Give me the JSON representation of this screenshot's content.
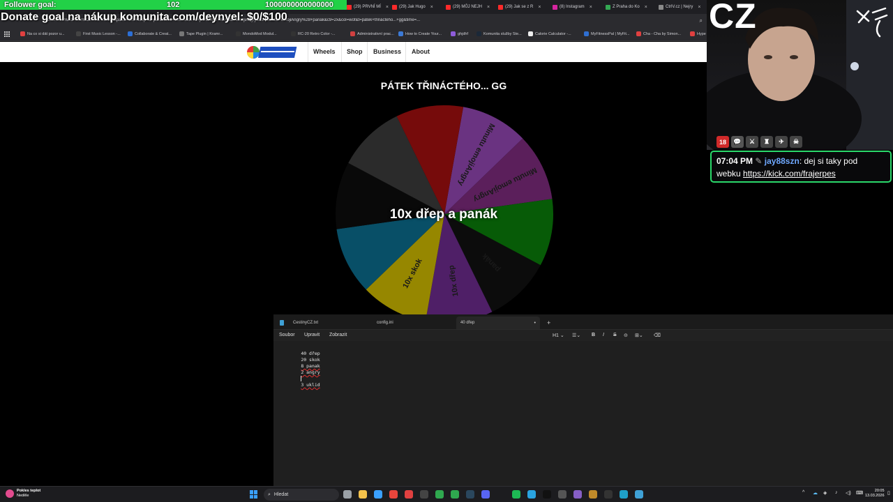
{
  "overlay": {
    "follower_goal_label": "Follower goal:",
    "follower_current": "102",
    "follower_target": "1000000000000000",
    "donate_text": "Donate goal na nákup komunita.com/deynyel: $0/$100"
  },
  "browser": {
    "tabs": [
      {
        "label": "(29) PRVNÍ MÍ",
        "color": "#ff2a2a"
      },
      {
        "label": "(29) Jak Hugo",
        "color": "#ff2a2a"
      },
      {
        "label": "(29) MŮJ NEJH",
        "color": "#ff2a2a"
      },
      {
        "label": "(29) Jak se z R",
        "color": "#ff2a2a"
      },
      {
        "label": "(8) Instagram",
        "color": "#d6249f"
      },
      {
        "label": "Z Praha do Ko",
        "color": "#34a853"
      },
      {
        "label": "CtrlV.cz | Nejry",
        "color": "#8a8a8a"
      }
    ],
    "url": "...coval%C3%A1+kov%C3%A1+hoodtrap&c5=10x+dřep+a+panák&c6=10x+skok+a+panák&c7=Minutu+emojiAngry&c8=Minutu+emojiAngry%28+panák&c9=2x&col=wof&t=pátek+třináctého...+gg&time=...",
    "bookmarks": [
      {
        "label": "Na co si dát pozor u...",
        "color": "#e04040"
      },
      {
        "label": "First Music Lesson -...",
        "color": "#444"
      },
      {
        "label": "Collaborate & Creat...",
        "color": "#2c6fd6"
      },
      {
        "label": "Tape Plugin | Kramr...",
        "color": "#777"
      },
      {
        "label": "MondoMod Modul...",
        "color": "#333"
      },
      {
        "label": "RC-20 Retro Color -...",
        "color": "#333"
      },
      {
        "label": "Administrativní prac...",
        "color": "#d04040"
      },
      {
        "label": "How to Create Your...",
        "color": "#3c7ad6"
      },
      {
        "label": "ghjdhf",
        "color": "#8e5cd9"
      },
      {
        "label": "Komunita služby Ste...",
        "color": "#1b2838"
      },
      {
        "label": "Calorie Calculator -...",
        "color": "#eee"
      },
      {
        "label": "MyFitnessPal | MyFit...",
        "color": "#2f6fd1"
      },
      {
        "label": "Cha - Cha by Simon...",
        "color": "#e04040"
      },
      {
        "label": "Hype",
        "color": "#e04040"
      }
    ]
  },
  "site": {
    "nav": [
      "Wheels",
      "Shop",
      "Business",
      "About"
    ],
    "wheel_title": "PÁTEK TŘINÁCTÉHO... GG",
    "result": "10x dřep a panák",
    "segments": [
      {
        "label": "Minutu emojiAngry",
        "color": "#8e44ad"
      },
      {
        "label": "Minutu emojiAngry",
        "color": "#7a2a7a"
      },
      {
        "label": "",
        "color": "#0a7a0a"
      },
      {
        "label": "panák",
        "color": "#111111"
      },
      {
        "label": "10x dřep",
        "color": "#6a2a8a"
      },
      {
        "label": "10x skok",
        "color": "#c8b400"
      },
      {
        "label": "",
        "color": "#0b6a8a"
      },
      {
        "label": "",
        "color": "#0d0d0d"
      },
      {
        "label": "",
        "color": "#3a3a3a"
      },
      {
        "label": "",
        "color": "#9e0f0f"
      }
    ]
  },
  "notepad": {
    "tabs": [
      "CestinyCZ.txt",
      "config.ini",
      "40 dřep"
    ],
    "menu": [
      "Soubor",
      "Upravit",
      "Zobrazit"
    ],
    "heading_label": "H1",
    "lines": [
      "40 dřep",
      "20 skok",
      "8 panak",
      "2 angry",
      "",
      "3 uklid"
    ]
  },
  "webcam": {
    "logo": "CZ",
    "badges": [
      {
        "label": "18",
        "color": "#d12a2a"
      },
      {
        "label": "💬",
        "color": "#555"
      },
      {
        "label": "⚔",
        "color": "#444"
      },
      {
        "label": "♜",
        "color": "#444"
      },
      {
        "label": "✈",
        "color": "#444"
      },
      {
        "label": "☠",
        "color": "#444"
      }
    ],
    "chat": {
      "time": "07:04 PM",
      "user": "jay88szn",
      "message": ": dej si taky pod",
      "message2": "webku ",
      "link": "https://kick.com/frajerpes"
    }
  },
  "taskbar": {
    "weather_title": "Pokles teplot",
    "weather_sub": "Neděle",
    "search_placeholder": "Hledat",
    "time": "20:05",
    "date": "13.03.2026"
  }
}
